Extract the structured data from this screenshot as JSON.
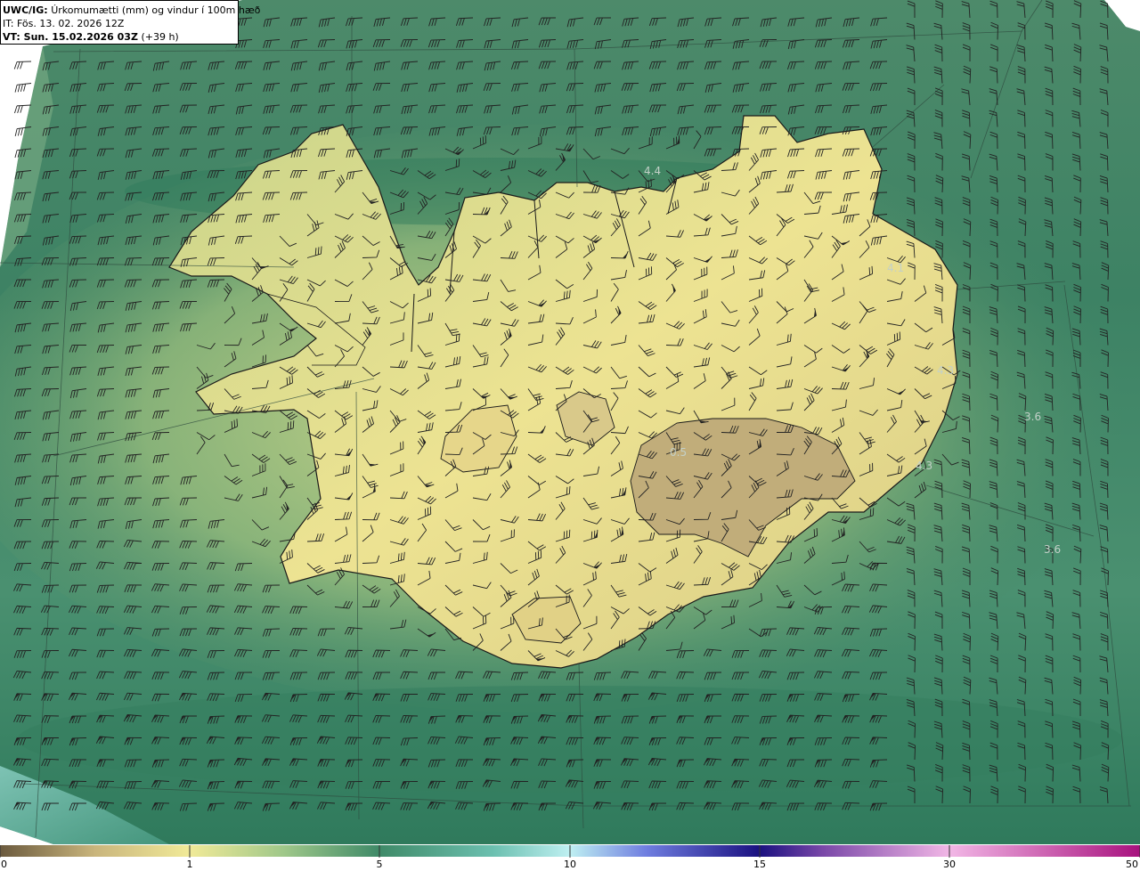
{
  "header": {
    "model_label": "UWC/IG:",
    "title": "Úrkomumætti (mm) og vindur í 100m hæð",
    "issue_time": "IT: Fös. 13. 02. 2026 12Z",
    "valid_label": "VT: Sun. 15.02.2026 03Z",
    "lead_time": "(+39 h)"
  },
  "map": {
    "region": "Iceland",
    "field_labels": [
      "4.4",
      "4.1",
      "4.3",
      "3.6",
      "4.3",
      "3.6",
      "0.5"
    ],
    "colors": {
      "ocean_dark": "#2f7a5c",
      "ocean_light": "#8fc7b4",
      "land_low": "#e5e08e",
      "land_high": "#b7a272",
      "coastline": "#1a1a1a",
      "barb": "#222222"
    },
    "wind_barbs_shown": true,
    "wind_direction_land": "variable",
    "wind_direction_sea": "south-westerly to westerly"
  },
  "colorbar": {
    "ticks": [
      "0",
      "1",
      "5",
      "10",
      "15",
      "30",
      "50"
    ],
    "unit": "mm",
    "stops": [
      {
        "value": 0,
        "color": "#6b5a3e"
      },
      {
        "value": 0.5,
        "color": "#c9b57c"
      },
      {
        "value": 1,
        "color": "#f1ea98"
      },
      {
        "value": 3,
        "color": "#9ec789"
      },
      {
        "value": 5,
        "color": "#3f8a68"
      },
      {
        "value": 8,
        "color": "#6cc0b0"
      },
      {
        "value": 10,
        "color": "#bff0f2"
      },
      {
        "value": 12,
        "color": "#6f7ee0"
      },
      {
        "value": 15,
        "color": "#1a1080"
      },
      {
        "value": 20,
        "color": "#7a48a8"
      },
      {
        "value": 30,
        "color": "#f2b7e6"
      },
      {
        "value": 50,
        "color": "#a8127e"
      }
    ]
  }
}
